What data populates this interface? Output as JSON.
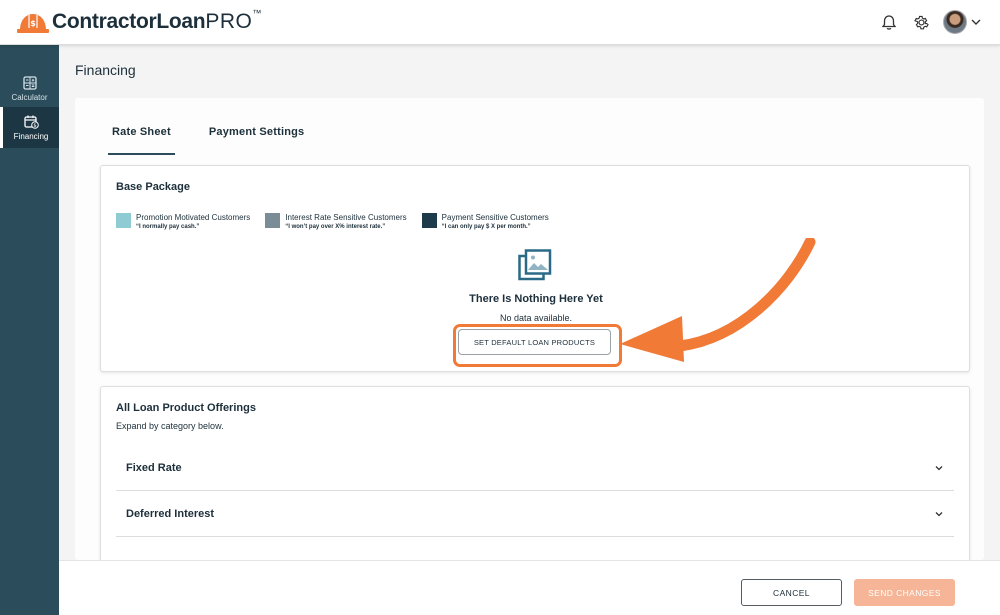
{
  "header": {
    "logo": {
      "main": "ContractorLoan",
      "accent": "PRO",
      "tm": "™"
    },
    "icons": [
      "bell-icon",
      "gear-icon",
      "avatar",
      "chevron-down-icon"
    ]
  },
  "sidebar": {
    "items": [
      {
        "label": "Calculator",
        "icon": "calculator-icon"
      },
      {
        "label": "Financing",
        "icon": "calendar-dollar-icon"
      }
    ]
  },
  "page": {
    "title": "Financing"
  },
  "tabs": [
    {
      "label": "Rate Sheet"
    },
    {
      "label": "Payment Settings"
    }
  ],
  "base_package": {
    "title": "Base Package",
    "legend": [
      {
        "name": "Promotion Motivated Customers",
        "quote": "“I normally pay cash.”",
        "color": "#8fcbd2"
      },
      {
        "name": "Interest Rate Sensitive Customers",
        "quote": "“I won’t pay over X% interest rate.”",
        "color": "#7a8d96"
      },
      {
        "name": "Payment Sensitive Customers",
        "quote": "“I can only pay $ X per month.”",
        "color": "#1d3b4a"
      }
    ],
    "empty_icon": "image-stack-icon",
    "empty_title": "There Is Nothing Here Yet",
    "empty_sub": "No data available.",
    "button_label": "SET DEFAULT LOAN PRODUCTS"
  },
  "offerings": {
    "title": "All Loan Product Offerings",
    "subtitle": "Expand by category below.",
    "categories": [
      {
        "label": "Fixed Rate"
      },
      {
        "label": "Deferred Interest"
      }
    ]
  },
  "footer": {
    "cancel_label": "CANCEL",
    "send_label": "SEND CHANGES"
  },
  "colors": {
    "brand_orange": "#f07a36",
    "sidebar": "#2a4c5b",
    "send_disabled": "#f5b596"
  }
}
